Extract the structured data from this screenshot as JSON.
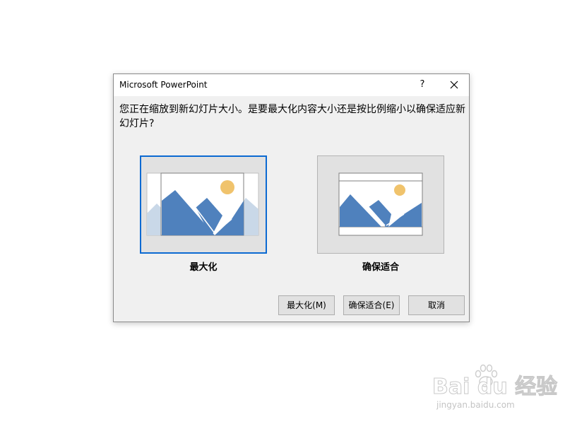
{
  "dialog": {
    "title": "Microsoft PowerPoint",
    "help_label": "?",
    "close_icon": "close-icon",
    "message": "您正在缩放到新幻灯片大小。是要最大化内容大小还是按比例缩小以确保适应新幻灯片?",
    "options": [
      {
        "label": "最大化",
        "selected": true,
        "icon": "maximize-preview-icon"
      },
      {
        "label": "确保适合",
        "selected": false,
        "icon": "ensure-fit-preview-icon"
      }
    ],
    "buttons": {
      "maximize": "最大化(M)",
      "ensure_fit": "确保适合(E)",
      "cancel": "取消"
    }
  },
  "watermark": {
    "main": "Bai du 经验",
    "sub": "jingyan.baidu.com"
  },
  "colors": {
    "selection_border": "#0b6ad2",
    "mountain": "#4f81bd",
    "mountain_faded": "#c9d8e8",
    "sun": "#f0c36c",
    "dialog_bg": "#f0f0f0"
  }
}
